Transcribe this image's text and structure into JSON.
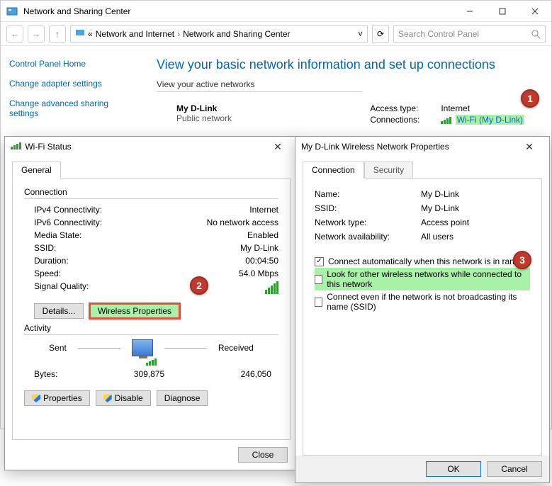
{
  "window": {
    "title": "Network and Sharing Center",
    "breadcrumb": [
      "Network and Internet",
      "Network and Sharing Center"
    ],
    "search_placeholder": "Search Control Panel"
  },
  "sidebar": {
    "home": "Control Panel Home",
    "links": [
      "Change adapter settings",
      "Change advanced sharing settings"
    ]
  },
  "main": {
    "heading": "View your basic network information and set up connections",
    "subhead": "View your active networks",
    "network_name": "My D-Link",
    "network_type": "Public network",
    "access_label": "Access type:",
    "access_value": "Internet",
    "conn_label": "Connections:",
    "conn_value": "Wi-Fi (My D-Link)"
  },
  "badges": {
    "one": "1",
    "two": "2",
    "three": "3"
  },
  "status": {
    "title": "Wi-Fi Status",
    "tab": "General",
    "group_connection": "Connection",
    "rows": {
      "ipv4_k": "IPv4 Connectivity:",
      "ipv4_v": "Internet",
      "ipv6_k": "IPv6 Connectivity:",
      "ipv6_v": "No network access",
      "media_k": "Media State:",
      "media_v": "Enabled",
      "ssid_k": "SSID:",
      "ssid_v": "My D-Link",
      "dur_k": "Duration:",
      "dur_v": "00:04:50",
      "speed_k": "Speed:",
      "speed_v": "54.0 Mbps",
      "sig_k": "Signal Quality:"
    },
    "details_btn": "Details...",
    "wprops_btn": "Wireless Properties",
    "group_activity": "Activity",
    "sent_label": "Sent",
    "recv_label": "Received",
    "bytes_label": "Bytes:",
    "bytes_sent": "309,875",
    "bytes_recv": "246,050",
    "props_btn": "Properties",
    "disable_btn": "Disable",
    "diag_btn": "Diagnose",
    "close_btn": "Close"
  },
  "props": {
    "title": "My D-Link Wireless Network Properties",
    "tab_conn": "Connection",
    "tab_sec": "Security",
    "name_k": "Name:",
    "name_v": "My D-Link",
    "ssid_k": "SSID:",
    "ssid_v": "My D-Link",
    "ntype_k": "Network type:",
    "ntype_v": "Access point",
    "avail_k": "Network availability:",
    "avail_v": "All users",
    "chk1": "Connect automatically when this network is in range",
    "chk2": "Look for other wireless networks while connected to this network",
    "chk3": "Connect even if the network is not broadcasting its name (SSID)",
    "ok": "OK",
    "cancel": "Cancel"
  }
}
